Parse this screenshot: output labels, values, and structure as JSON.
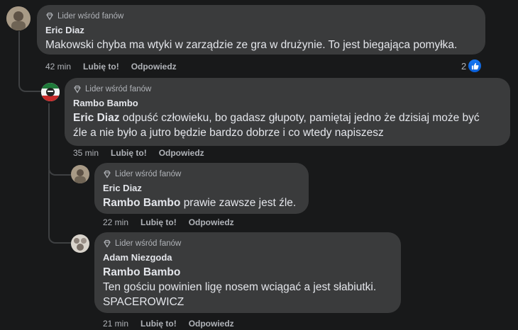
{
  "comments": [
    {
      "badge": "Lider wśród fanów",
      "author": "Eric Diaz",
      "mention": "",
      "text": "Makowski chyba ma wtyki w zarządzie ze gra w drużynie. To jest biegająca pomyłka.",
      "time": "42 min",
      "like_label": "Lubię to!",
      "reply_label": "Odpowiedz",
      "reaction_count": "2"
    },
    {
      "badge": "Lider wśród fanów",
      "author": "Rambo Bambo",
      "mention": "Eric Diaz",
      "text_line1": "odpuść człowieku, bo gadasz głupoty, pamiętaj jedno że dzisiaj może być",
      "text_line2": "źle a nie było a jutro będzie bardzo dobrze i co wtedy napiszesz",
      "time": "35 min",
      "like_label": "Lubię to!",
      "reply_label": "Odpowiedz"
    },
    {
      "badge": "Lider wśród fanów",
      "author": "Eric Diaz",
      "mention": "Rambo Bambo",
      "text": "prawie zawsze jest źle.",
      "time": "22 min",
      "like_label": "Lubię to!",
      "reply_label": "Odpowiedz"
    },
    {
      "badge": "Lider wśród fanów",
      "author": "Adam Niezgoda",
      "mention": "Rambo Bambo",
      "text_line1": "Ten gościu powinien ligę nosem wciągać a jest słabiutki.",
      "text_line2": "SPACEROWICZ",
      "time": "21 min",
      "like_label": "Lubię to!",
      "reply_label": "Odpowiedz"
    }
  ],
  "colors": {
    "background": "#18191a",
    "bubble": "#3a3b3c",
    "like_blue": "#1877f2"
  }
}
